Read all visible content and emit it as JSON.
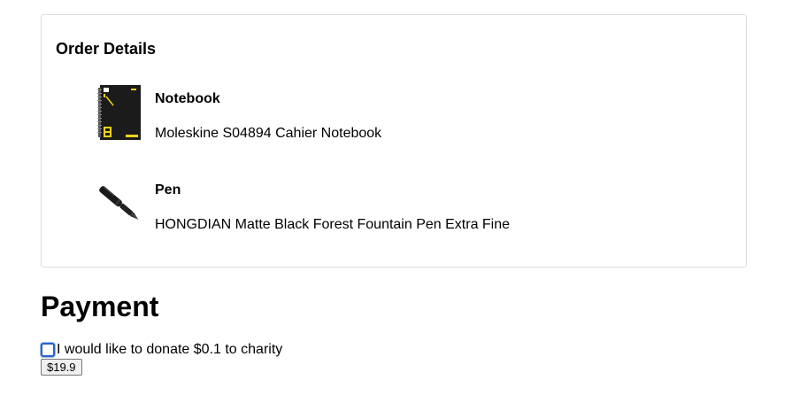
{
  "order": {
    "title": "Order Details",
    "items": [
      {
        "name": "Notebook",
        "description": "Moleskine S04894 Cahier Notebook",
        "thumbnail_icon": "notebook-icon"
      },
      {
        "name": "Pen",
        "description": "HONGDIAN Matte Black Forest Fountain Pen Extra Fine",
        "thumbnail_icon": "fountain-pen-icon"
      }
    ]
  },
  "payment": {
    "title": "Payment",
    "donate_label": "I would like to donate $0.1 to charity",
    "donate_checked": false,
    "pay_button_label": "$19.9"
  },
  "colors": {
    "checkbox_focus": "#2a62c9",
    "card_border": "#dcdcdc",
    "notebook_accent": "#f2d21b"
  }
}
